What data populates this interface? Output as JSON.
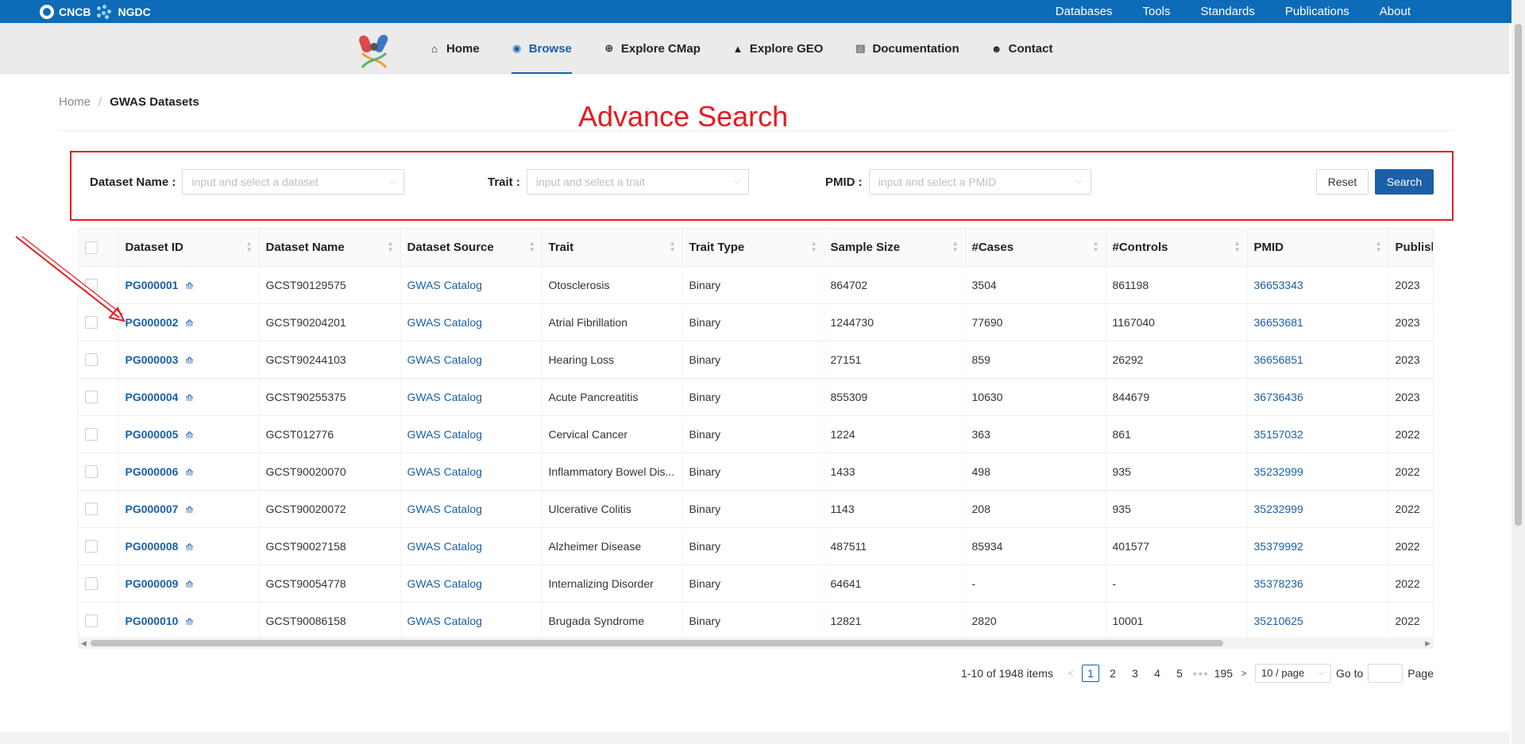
{
  "topbar": {
    "logo_left": "CNCB",
    "logo_right": "NGDC",
    "links": [
      "Databases",
      "Tools",
      "Standards",
      "Publications",
      "About"
    ]
  },
  "nav": {
    "items": [
      {
        "label": "Home",
        "icon": "home-icon"
      },
      {
        "label": "Browse",
        "icon": "eye-icon"
      },
      {
        "label": "Explore CMap",
        "icon": "binoculars-icon"
      },
      {
        "label": "Explore GEO",
        "icon": "mountain-icon"
      },
      {
        "label": "Documentation",
        "icon": "document-icon"
      },
      {
        "label": "Contact",
        "icon": "contact-icon"
      }
    ],
    "active": "Browse"
  },
  "breadcrumb": {
    "home": "Home",
    "sep": "/",
    "current": "GWAS Datasets"
  },
  "annotation": {
    "title": "Advance Search",
    "color": "#e8191f"
  },
  "filters": {
    "dataset_label": "Dataset Name",
    "dataset_placeholder": "input and select a dataset",
    "trait_label": "Trait",
    "trait_placeholder": "input and select a trait",
    "pmid_label": "PMID",
    "pmid_placeholder": "input and select a PMID",
    "reset": "Reset",
    "search": "Search"
  },
  "table": {
    "columns": [
      "Dataset ID",
      "Dataset Name",
      "Dataset Source",
      "Trait",
      "Trait Type",
      "Sample Size",
      "#Cases",
      "#Controls",
      "PMID",
      "Publish"
    ],
    "rows": [
      {
        "id": "PG000001",
        "name": "GCST90129575",
        "source": "GWAS Catalog",
        "trait": "Otosclerosis",
        "type": "Binary",
        "size": "864702",
        "cases": "3504",
        "controls": "861198",
        "pmid": "36653343",
        "year": "2023"
      },
      {
        "id": "PG000002",
        "name": "GCST90204201",
        "source": "GWAS Catalog",
        "trait": "Atrial Fibrillation",
        "type": "Binary",
        "size": "1244730",
        "cases": "77690",
        "controls": "1167040",
        "pmid": "36653681",
        "year": "2023"
      },
      {
        "id": "PG000003",
        "name": "GCST90244103",
        "source": "GWAS Catalog",
        "trait": "Hearing Loss",
        "type": "Binary",
        "size": "27151",
        "cases": "859",
        "controls": "26292",
        "pmid": "36656851",
        "year": "2023"
      },
      {
        "id": "PG000004",
        "name": "GCST90255375",
        "source": "GWAS Catalog",
        "trait": "Acute Pancreatitis",
        "type": "Binary",
        "size": "855309",
        "cases": "10630",
        "controls": "844679",
        "pmid": "36736436",
        "year": "2023"
      },
      {
        "id": "PG000005",
        "name": "GCST012776",
        "source": "GWAS Catalog",
        "trait": "Cervical Cancer",
        "type": "Binary",
        "size": "1224",
        "cases": "363",
        "controls": "861",
        "pmid": "35157032",
        "year": "2022"
      },
      {
        "id": "PG000006",
        "name": "GCST90020070",
        "source": "GWAS Catalog",
        "trait": "Inflammatory Bowel Dis...",
        "type": "Binary",
        "size": "1433",
        "cases": "498",
        "controls": "935",
        "pmid": "35232999",
        "year": "2022"
      },
      {
        "id": "PG000007",
        "name": "GCST90020072",
        "source": "GWAS Catalog",
        "trait": "Ulcerative Colitis",
        "type": "Binary",
        "size": "1143",
        "cases": "208",
        "controls": "935",
        "pmid": "35232999",
        "year": "2022"
      },
      {
        "id": "PG000008",
        "name": "GCST90027158",
        "source": "GWAS Catalog",
        "trait": "Alzheimer Disease",
        "type": "Binary",
        "size": "487511",
        "cases": "85934",
        "controls": "401577",
        "pmid": "35379992",
        "year": "2022"
      },
      {
        "id": "PG000009",
        "name": "GCST90054778",
        "source": "GWAS Catalog",
        "trait": "Internalizing Disorder",
        "type": "Binary",
        "size": "64641",
        "cases": "-",
        "controls": "-",
        "pmid": "35378236",
        "year": "2022"
      },
      {
        "id": "PG000010",
        "name": "GCST90086158",
        "source": "GWAS Catalog",
        "trait": "Brugada Syndrome",
        "type": "Binary",
        "size": "12821",
        "cases": "2820",
        "controls": "10001",
        "pmid": "35210625",
        "year": "2022"
      }
    ]
  },
  "pagination": {
    "total": "1-10 of 1948 items",
    "pages": [
      "1",
      "2",
      "3",
      "4",
      "5"
    ],
    "ellipsis": "•••",
    "last": "195",
    "page_size": "10 / page",
    "goto_label": "Go to",
    "page_label": "Page"
  }
}
